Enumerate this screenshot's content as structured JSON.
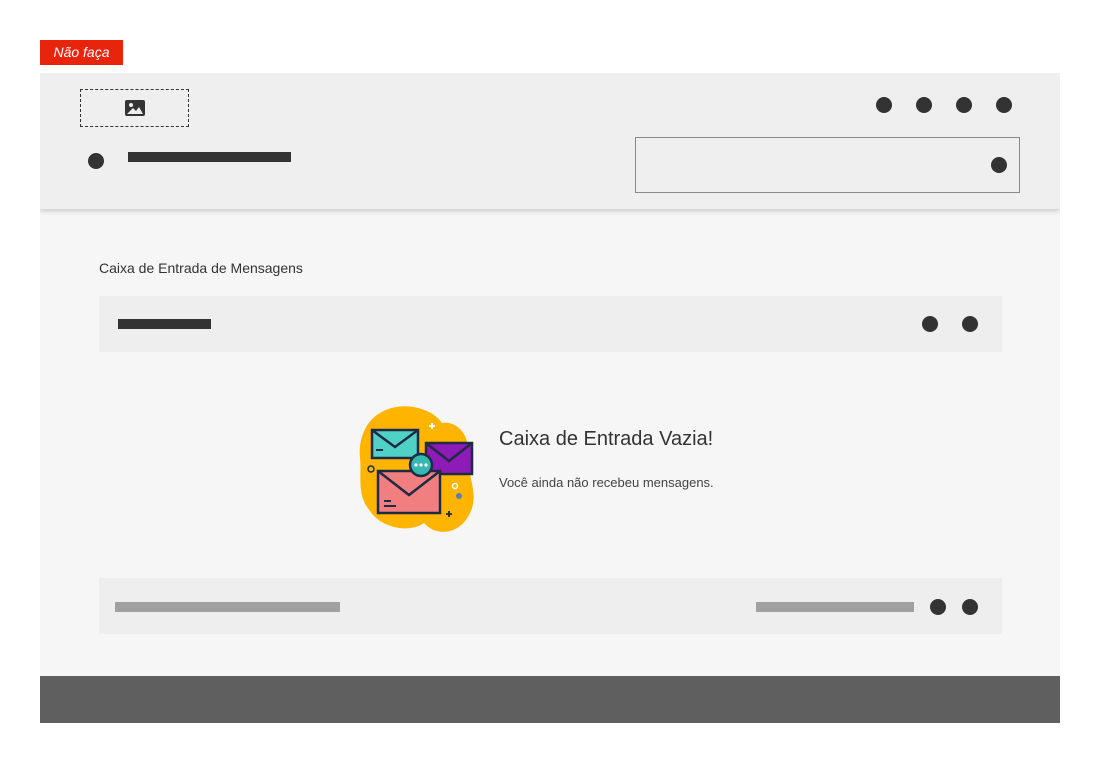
{
  "tag": {
    "label": "Não faça"
  },
  "header": {
    "logo_icon": "image-icon",
    "top_actions": [
      "nav-dot-icon",
      "nav-dot-icon",
      "nav-dot-icon",
      "nav-dot-icon"
    ],
    "menu_icon": "menu-dot-icon",
    "search_icon": "search-dot-icon"
  },
  "inbox": {
    "title": "Caixa de Entrada de Mensagens",
    "empty_title": "Caixa de Entrada Vazia!",
    "empty_message": "Você ainda não recebeu mensagens.",
    "illustration_icon": "envelopes-icon"
  },
  "colors": {
    "tag": "#e8250c",
    "header_bg": "#f0efef",
    "page_bg": "#f6f6f6",
    "footer_bg": "#5f5f5f",
    "placeholder_dark": "#333333",
    "placeholder_light": "#a0a0a0"
  }
}
